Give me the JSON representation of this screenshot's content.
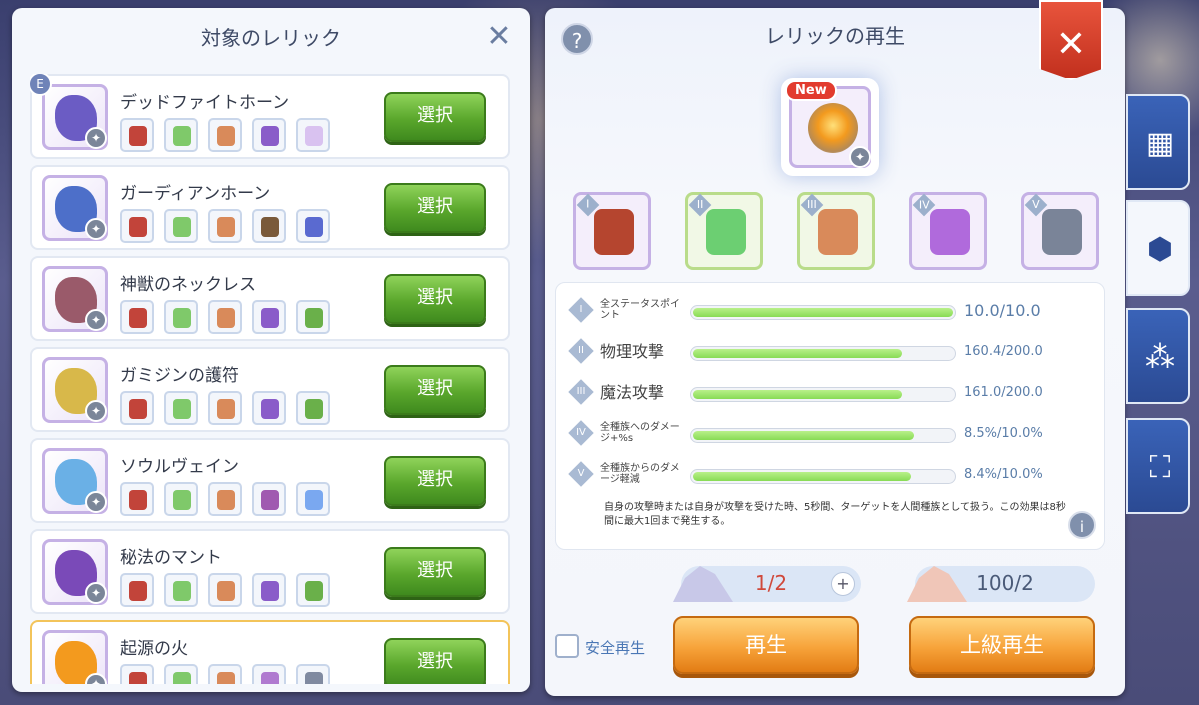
{
  "left_panel": {
    "title": "対象のレリック",
    "select_label": "選択",
    "e_badge": "E",
    "relics": [
      {
        "name": "デッドファイトホーン",
        "art_color": "#6b5cc4",
        "mats": [
          "#c2443a",
          "#7fc96a",
          "#d98a5a",
          "#8a5cc9",
          "#d9c2f0"
        ]
      },
      {
        "name": "ガーディアンホーン",
        "art_color": "#4d6fc9",
        "mats": [
          "#c2443a",
          "#7fc96a",
          "#d98a5a",
          "#7a5a3a",
          "#5a6ad0"
        ]
      },
      {
        "name": "神獣のネックレス",
        "art_color": "#9a5a6a",
        "mats": [
          "#c2443a",
          "#7fc96a",
          "#d98a5a",
          "#8a5cc9",
          "#6ab04a"
        ]
      },
      {
        "name": "ガミジンの護符",
        "art_color": "#d8b84a",
        "mats": [
          "#c2443a",
          "#7fc96a",
          "#d98a5a",
          "#8a5cc9",
          "#6ab04a"
        ]
      },
      {
        "name": "ソウルヴェイン",
        "art_color": "#6ab0e6",
        "mats": [
          "#c2443a",
          "#7fc96a",
          "#d98a5a",
          "#a05ab0",
          "#7aa8f0"
        ]
      },
      {
        "name": "秘法のマント",
        "art_color": "#7a4ab8",
        "mats": [
          "#c2443a",
          "#7fc96a",
          "#d98a5a",
          "#8a5cc9",
          "#6ab04a"
        ]
      },
      {
        "name": "起源の火",
        "art_color": "#f39a1e",
        "mats": [
          "#c2443a",
          "#7fc96a",
          "#d98a5a",
          "#b07ad0",
          "#808aa0"
        ]
      }
    ]
  },
  "right_panel": {
    "title": "レリックの再生",
    "help": "?",
    "close": "✕",
    "new_tag": "New",
    "slots": [
      {
        "roman": "I",
        "color": "#b5452f",
        "style": "purple"
      },
      {
        "roman": "II",
        "color": "#6ccf72",
        "style": "green"
      },
      {
        "roman": "III",
        "color": "#d98a5a",
        "style": "green"
      },
      {
        "roman": "IV",
        "color": "#b06adc",
        "style": "purple"
      },
      {
        "roman": "V",
        "color": "#7a8498",
        "style": "purple"
      }
    ],
    "stats": [
      {
        "roman": "I",
        "label": "全ステータスポイント",
        "value": "10.0/10.0",
        "fill": 1.0,
        "big_label": false,
        "big_value": true
      },
      {
        "roman": "II",
        "label": "物理攻撃",
        "value": "160.4/200.0",
        "fill": 0.802,
        "big_label": true,
        "big_value": false
      },
      {
        "roman": "III",
        "label": "魔法攻撃",
        "value": "161.0/200.0",
        "fill": 0.805,
        "big_label": true,
        "big_value": false
      },
      {
        "roman": "IV",
        "label": "全種族へのダメージ+%s",
        "value": "8.5%/10.0%",
        "fill": 0.85,
        "big_label": false,
        "big_value": false
      },
      {
        "roman": "V",
        "label": "全種族からのダメージ軽減",
        "value": "8.4%/10.0%",
        "fill": 0.84,
        "big_label": false,
        "big_value": false
      }
    ],
    "description": "自身の攻撃時または自身が攻撃を受けた時、5秒間、ターゲットを人間種族として扱う。この効果は8秒間に最大1回まで発生する。",
    "info": "i",
    "cost1": {
      "text": "1/2",
      "color": "#d0483a",
      "plus": "+"
    },
    "cost2": {
      "text": "100/2",
      "color": "#4a5a78"
    },
    "safe_label": "安全再生",
    "regen_label": "再生",
    "adv_regen_label": "上級再生"
  },
  "side_tabs": [
    {
      "icon": "shop-icon",
      "glyph": "▦"
    },
    {
      "icon": "relic-icon",
      "glyph": "⬢"
    },
    {
      "icon": "nodes-icon",
      "glyph": "⁂"
    },
    {
      "icon": "frame-icon",
      "glyph": "⛶"
    }
  ]
}
